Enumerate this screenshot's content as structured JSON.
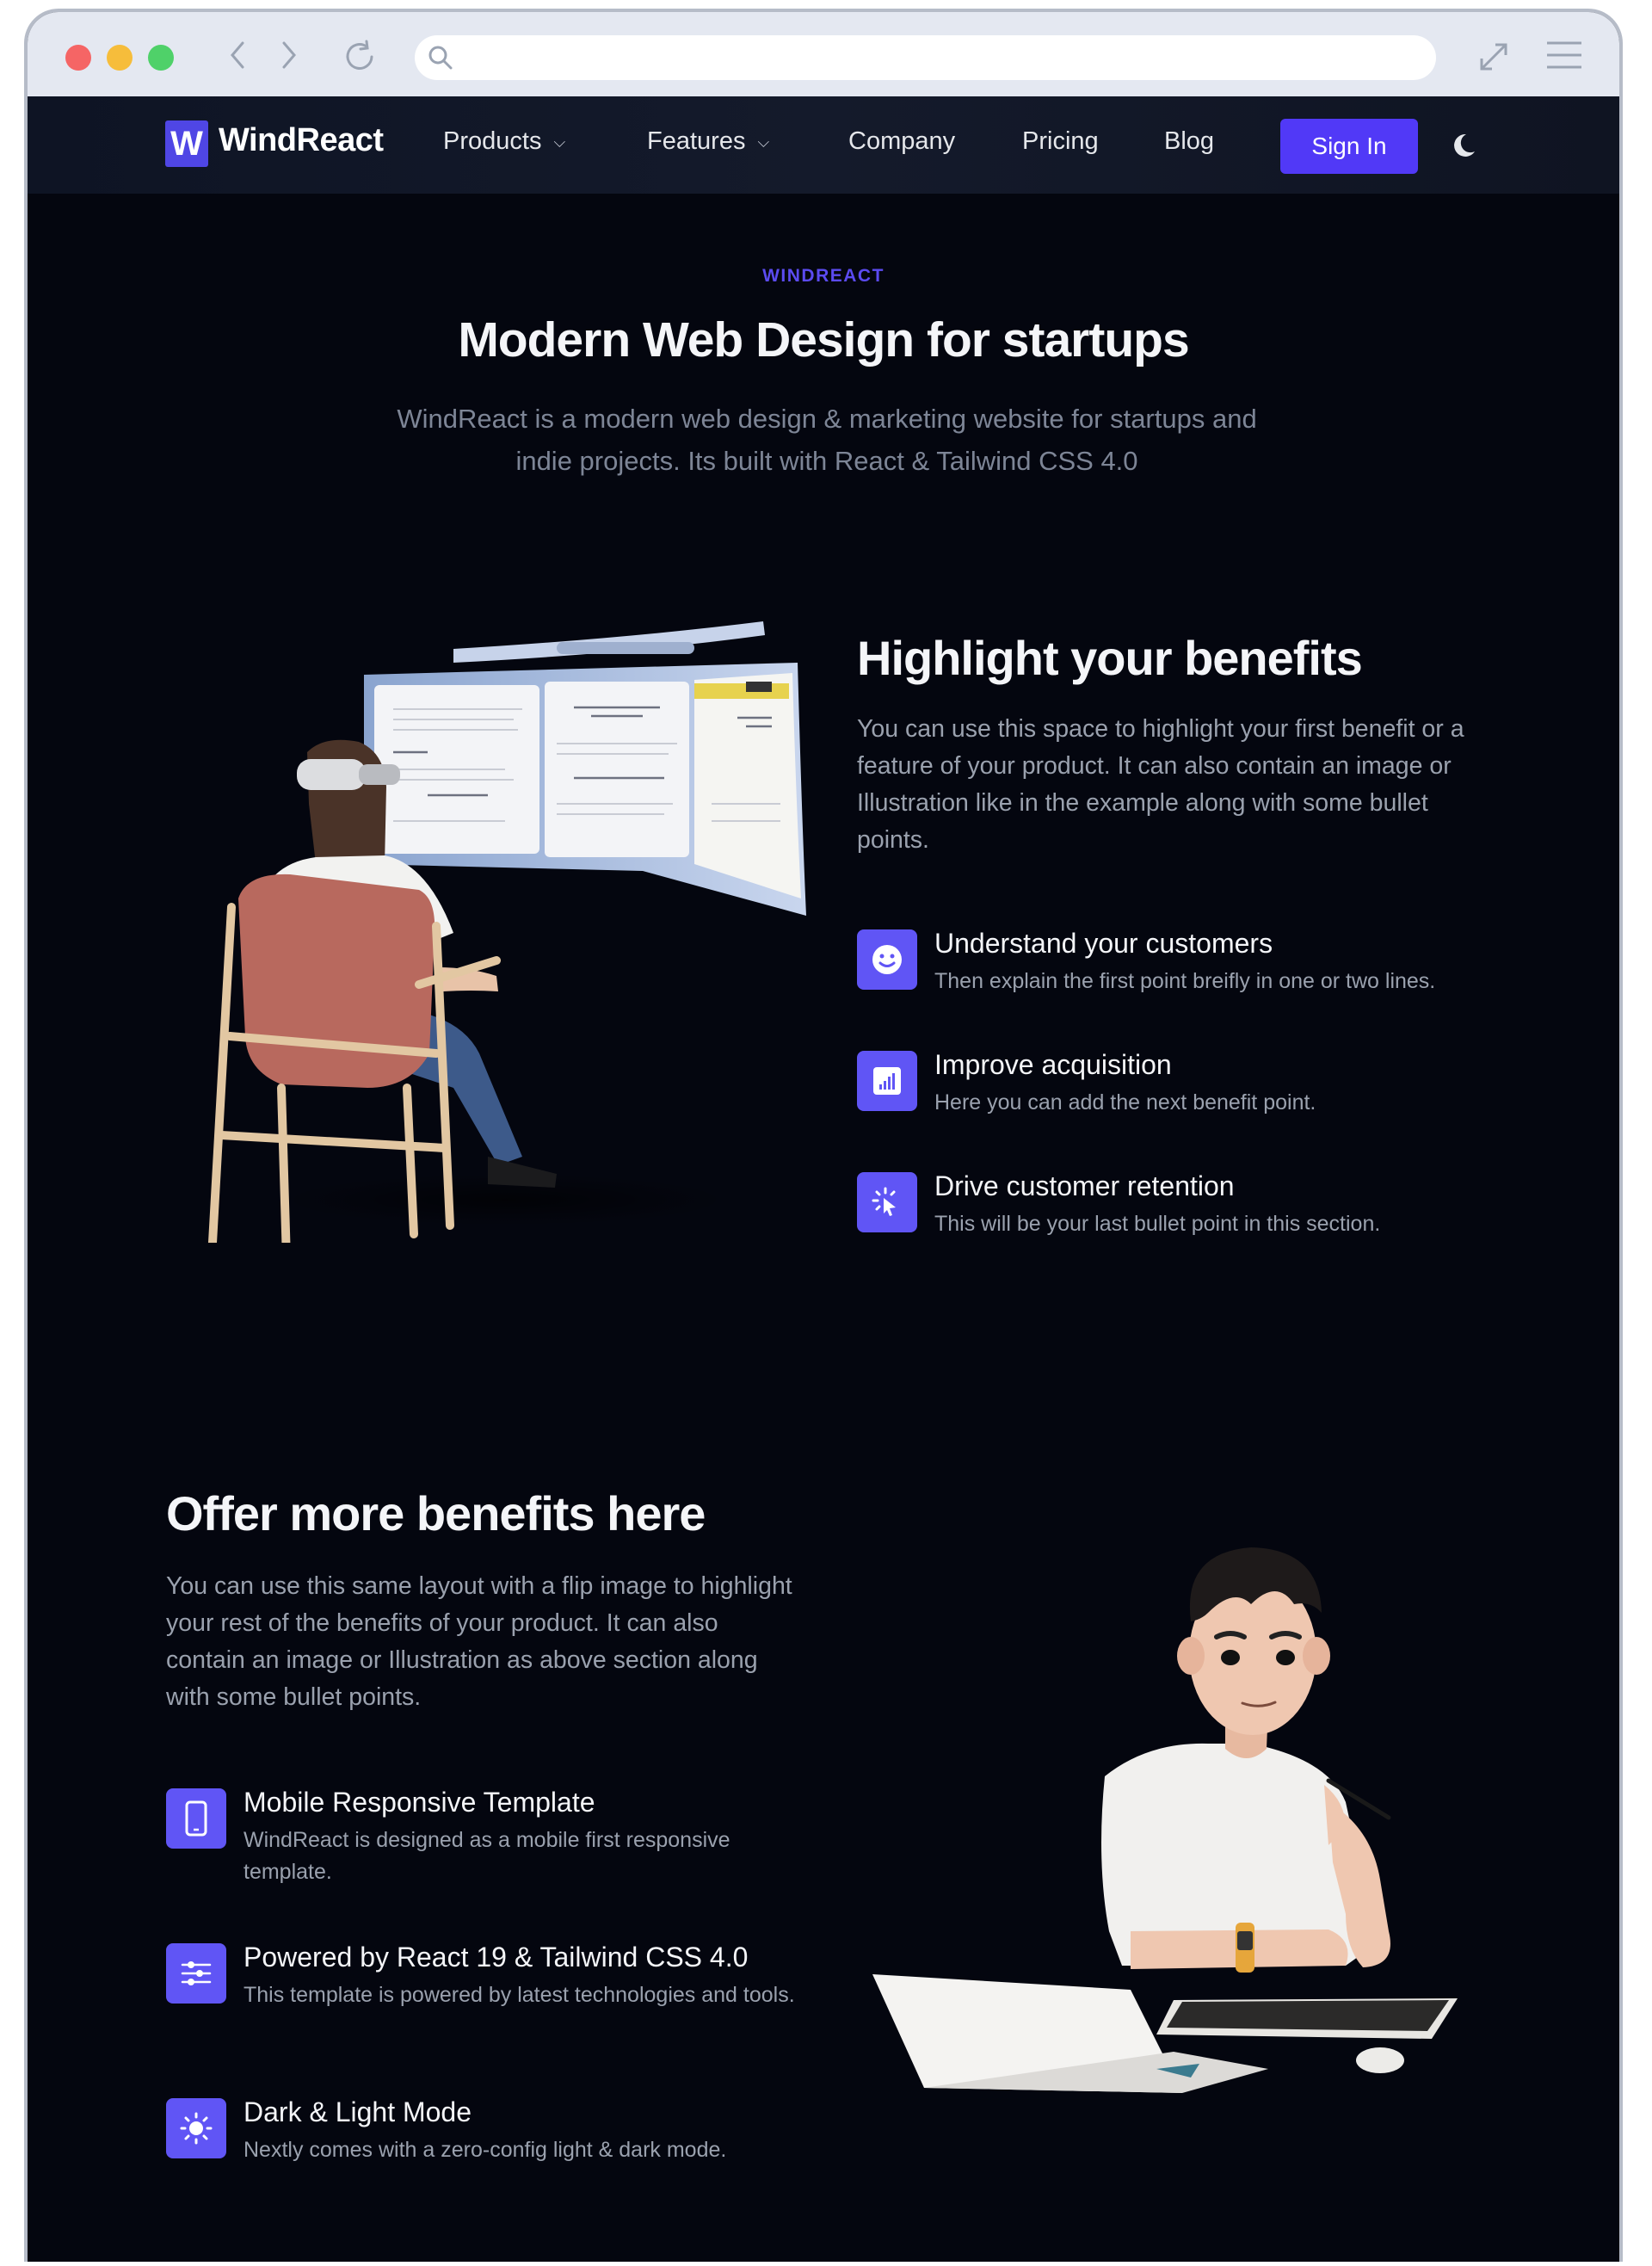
{
  "browser": {
    "window_controls": [
      "close",
      "minimize",
      "maximize"
    ],
    "nav_icons": [
      "back-icon",
      "forward-icon",
      "reload-icon"
    ],
    "address_bar": {
      "value": "",
      "placeholder": ""
    },
    "right_icons": [
      "expand-icon",
      "menu-icon"
    ]
  },
  "nav": {
    "logo_mark": "W",
    "logo_text": "WindReact",
    "links": [
      {
        "label": "Products",
        "has_dropdown": true
      },
      {
        "label": "Features",
        "has_dropdown": true
      },
      {
        "label": "Company",
        "has_dropdown": false
      },
      {
        "label": "Pricing",
        "has_dropdown": false
      },
      {
        "label": "Blog",
        "has_dropdown": false
      }
    ],
    "signin_label": "Sign In",
    "theme_toggle_icon": "moon-icon"
  },
  "hero": {
    "eyebrow": "WINDREACT",
    "title": "Modern Web Design for startups",
    "subtitle": "WindReact is a modern web design & marketing website for startups and indie projects. Its built with React & Tailwind CSS 4.0"
  },
  "section1": {
    "title": "Highlight your benefits",
    "paragraph": "You can use this space to highlight your first benefit or a feature of your product. It can also contain an image or Illustration like in the example along with some bullet points.",
    "illustration": "woman-in-vr-headset-illustration",
    "bullets": [
      {
        "icon": "smiley-icon",
        "title": "Understand your customers",
        "desc": "Then explain the first point breifly in one or two lines."
      },
      {
        "icon": "chart-icon",
        "title": "Improve acquisition",
        "desc": "Here you can add the next benefit point."
      },
      {
        "icon": "cursor-click-icon",
        "title": "Drive customer retention",
        "desc": "This will be your last bullet point in this section."
      }
    ]
  },
  "section2": {
    "title": "Offer more benefits here",
    "paragraph": "You can use this same layout with a flip image to highlight your rest of the benefits of your product. It can also contain an image or Illustration as above section along with some bullet points.",
    "illustration": "man-at-laptop-illustration",
    "bullets": [
      {
        "icon": "mobile-icon",
        "title": "Mobile Responsive Template",
        "desc": "WindReact is designed as a mobile first responsive template."
      },
      {
        "icon": "sliders-icon",
        "title": "Powered by React 19 & Tailwind CSS 4.0",
        "desc": "This template is powered by latest technologies and tools."
      },
      {
        "icon": "sun-icon",
        "title": "Dark & Light Mode",
        "desc": "Nextly comes with a zero-config light & dark mode."
      }
    ]
  },
  "colors": {
    "accent": "#5139f7",
    "icon_bg": "#6055f5",
    "eyebrow": "#5b4bf0",
    "page_bg": "#04060f",
    "nav_bg": "#121829",
    "heading": "#f4f5f8",
    "body_text": "#9aa1ae"
  }
}
